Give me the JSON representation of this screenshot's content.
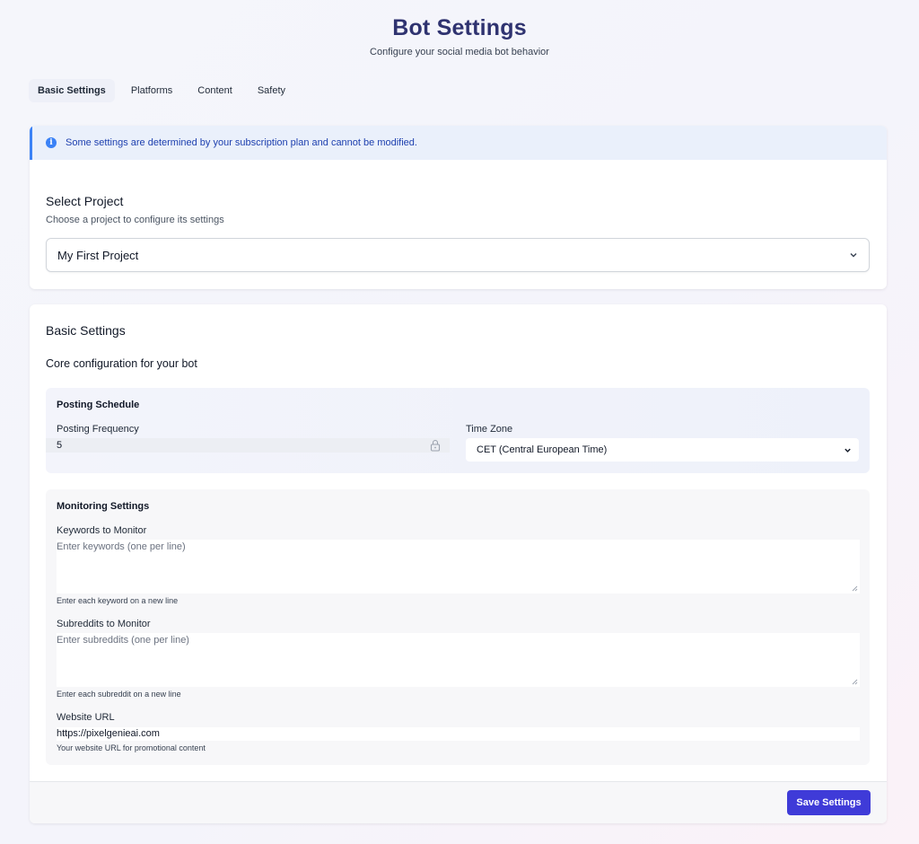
{
  "header": {
    "title": "Bot Settings",
    "subtitle": "Configure your social media bot behavior"
  },
  "tabs": [
    {
      "label": "Basic Settings",
      "active": true
    },
    {
      "label": "Platforms",
      "active": false
    },
    {
      "label": "Content",
      "active": false
    },
    {
      "label": "Safety",
      "active": false
    }
  ],
  "notice": {
    "icon": "info-icon",
    "text": "Some settings are determined by your subscription plan and cannot be modified."
  },
  "project": {
    "title": "Select Project",
    "description": "Choose a project to configure its settings",
    "selected": "My First Project"
  },
  "basic_settings": {
    "title": "Basic Settings",
    "description": "Core configuration for your bot",
    "posting_schedule": {
      "title": "Posting Schedule",
      "frequency_label": "Posting Frequency",
      "frequency_value": "5",
      "frequency_locked": true,
      "timezone_label": "Time Zone",
      "timezone_value": "CET (Central European Time)"
    },
    "monitoring": {
      "title": "Monitoring Settings",
      "keywords_label": "Keywords to Monitor",
      "keywords_placeholder": "Enter keywords (one per line)",
      "keywords_hint": "Enter each keyword on a new line",
      "subreddits_label": "Subreddits to Monitor",
      "subreddits_placeholder": "Enter subreddits (one per line)",
      "subreddits_hint": "Enter each subreddit on a new line",
      "website_label": "Website URL",
      "website_value": "https://pixelgenieai.com",
      "website_hint": "Your website URL for promotional content"
    }
  },
  "footer": {
    "save_label": "Save Settings"
  },
  "colors": {
    "accent": "#3f3bd8",
    "title": "#2f3370",
    "notice_bg": "#eaf0fb",
    "notice_border": "#3b82f6"
  }
}
